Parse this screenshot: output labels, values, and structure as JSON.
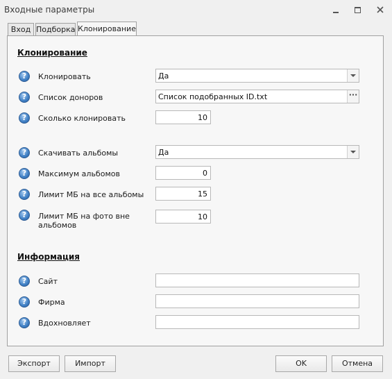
{
  "window": {
    "title": "Входные параметры"
  },
  "tabs": [
    {
      "label": "Вход"
    },
    {
      "label": "Подборка"
    },
    {
      "label": "Клонирование",
      "active": true
    }
  ],
  "cloning": {
    "section_title": "Клонирование",
    "clone": {
      "label": "Клонировать",
      "value": "Да"
    },
    "donor_list": {
      "label": "Список доноров",
      "value": "Список подобранных ID.txt"
    },
    "clone_count": {
      "label": "Сколько клонировать",
      "value": "10"
    },
    "download_albums": {
      "label": "Скачивать альбомы",
      "value": "Да"
    },
    "max_albums": {
      "label": "Максимум альбомов",
      "value": "0"
    },
    "mb_limit_albums": {
      "label": "Лимит МБ на все альбомы",
      "value": "15"
    },
    "mb_limit_photos_line1": "Лимит МБ на фото вне",
    "mb_limit_photos_line2": "альбомов",
    "mb_limit_photos_value": "10"
  },
  "info": {
    "section_title": "Информация",
    "site": {
      "label": "Сайт",
      "value": ""
    },
    "company": {
      "label": "Фирма",
      "value": ""
    },
    "inspired_by": {
      "label": "Вдохновляет",
      "value": ""
    }
  },
  "footer": {
    "export_label": "Экспорт",
    "import_label": "Импорт",
    "ok_label": "OK",
    "cancel_label": "Отмена"
  },
  "icons": {
    "help": "help-icon",
    "minimize": "minimize-icon",
    "maximize": "maximize-icon",
    "close": "close-icon",
    "dropdown": "chevron-down-icon",
    "browse": "ellipsis-icon"
  }
}
